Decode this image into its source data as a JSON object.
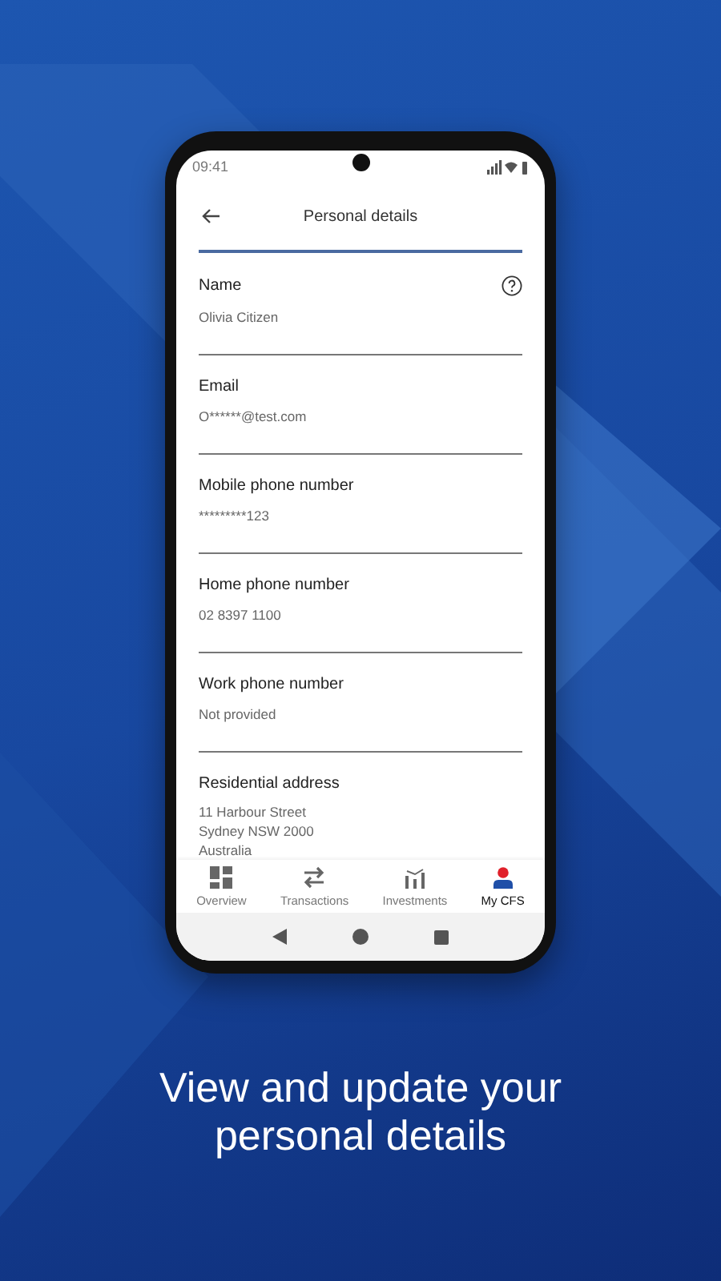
{
  "status_bar": {
    "time": "09:41"
  },
  "header": {
    "title": "Personal details"
  },
  "fields": [
    {
      "label": "Name",
      "value": "Olivia Citizen",
      "help": true
    },
    {
      "label": "Email",
      "value": "O******@test.com",
      "help": false
    },
    {
      "label": "Mobile phone number",
      "value": "*********123",
      "help": false
    },
    {
      "label": "Home phone number",
      "value": "02 8397 1100",
      "help": false
    },
    {
      "label": "Work phone number",
      "value": "Not provided",
      "help": false
    }
  ],
  "address": {
    "label": "Residential address",
    "lines": [
      "11 Harbour Street",
      "Sydney NSW 2000",
      "Australia"
    ]
  },
  "nav": [
    {
      "label": "Overview",
      "kind": "grid",
      "selected": false
    },
    {
      "label": "Transactions",
      "kind": "arrows",
      "selected": false
    },
    {
      "label": "Investments",
      "kind": "chart",
      "selected": false
    },
    {
      "label": "My CFS",
      "kind": "person",
      "selected": true
    }
  ],
  "caption": "View and update your personal details"
}
